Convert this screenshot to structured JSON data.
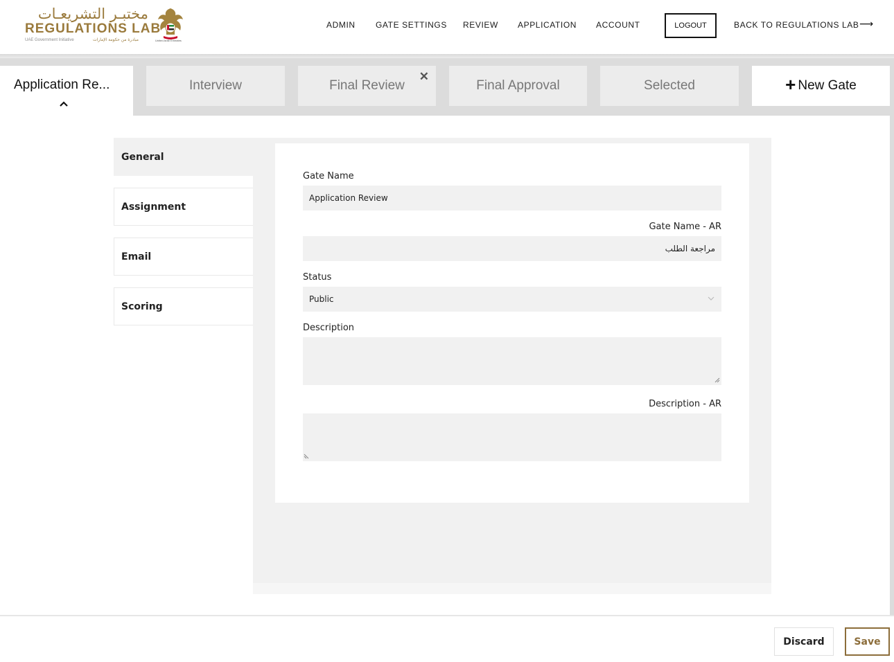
{
  "header": {
    "logo": {
      "arabic_title": "مختبـر التشريعـات",
      "english_title": "REGULATIONS LAB",
      "subtitle_en": "UAE Government Initiative",
      "subtitle_ar": "مبادرة من حكومة الإمارات",
      "emblem_caption": "United Arab Emirates"
    },
    "nav": {
      "admin": "ADMIN",
      "gate_settings": "GATE SETTINGS",
      "review": "REVIEW",
      "application": "APPLICATION",
      "account": "ACCOUNT",
      "logout": "LOGOUT",
      "back": "BACK TO REGULATIONS LAB",
      "back_arrow": "⟶"
    }
  },
  "gate_tabs": {
    "active": "Application Re...",
    "items": [
      "Interview",
      "Final Review",
      "Final Approval",
      "Selected"
    ],
    "close_glyph": "✕",
    "new_gate": "New Gate",
    "new_gate_glyph": "+"
  },
  "side_menu": {
    "items": [
      "General",
      "Assignment",
      "Email",
      "Scoring"
    ],
    "active_index": 0
  },
  "form": {
    "gate_name_label": "Gate Name",
    "gate_name_value": "Application Review",
    "gate_name_ar_label": "Gate Name - AR",
    "gate_name_ar_value": "مراجعة الطلب",
    "status_label": "Status",
    "status_value": "Public",
    "description_label": "Description",
    "description_value": "",
    "description_ar_label": "Description - AR",
    "description_ar_value": ""
  },
  "footer": {
    "discard": "Discard",
    "save": "Save"
  },
  "colors": {
    "brand_gold": "#9a7a3c",
    "save_border": "#8c6d3a",
    "tab_bar": "#dcdcdc",
    "field_bg": "#f1f1f1"
  }
}
